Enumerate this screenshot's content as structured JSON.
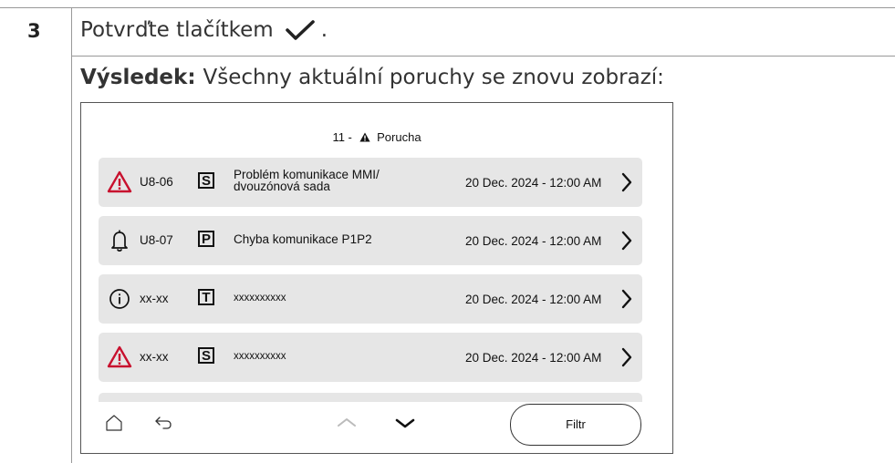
{
  "step": {
    "number": "3",
    "instruction": "Potvrďte tlačítkem",
    "instruction_end": ".",
    "result_label": "Výsledek:",
    "result_text": "Všechny aktuální poruchy se znovu zobrazí:"
  },
  "screen": {
    "title_prefix": "11 -",
    "title": "Porucha",
    "rows": [
      {
        "icon": "warning-triangle-icon",
        "code": "U8-06",
        "letter": "S",
        "desc_line1": "Problém komunikace MMI/",
        "desc_line2": "dvouzónová sada",
        "date": "20 Dec. 2024 - 12:00 AM"
      },
      {
        "icon": "bell-icon",
        "code": "U8-07",
        "letter": "P",
        "desc_line1": "Chyba komunikace P1P2",
        "date": "20 Dec. 2024 - 12:00 AM"
      },
      {
        "icon": "info-icon",
        "code": "xx-xx",
        "letter": "T",
        "desc_line1": "xxxxxxxxxx",
        "date": "20 Dec. 2024 - 12:00 AM"
      },
      {
        "icon": "warning-triangle-icon",
        "code": "xx-xx",
        "letter": "S",
        "desc_line1": "xxxxxxxxxx",
        "date": "20 Dec. 2024 - 12:00 AM"
      }
    ],
    "filter_label": "Filtr"
  },
  "colors": {
    "warning_red": "#c8102e",
    "row_bg": "#e6e6e6",
    "scroll_up_disabled": "#bbbbbb"
  }
}
